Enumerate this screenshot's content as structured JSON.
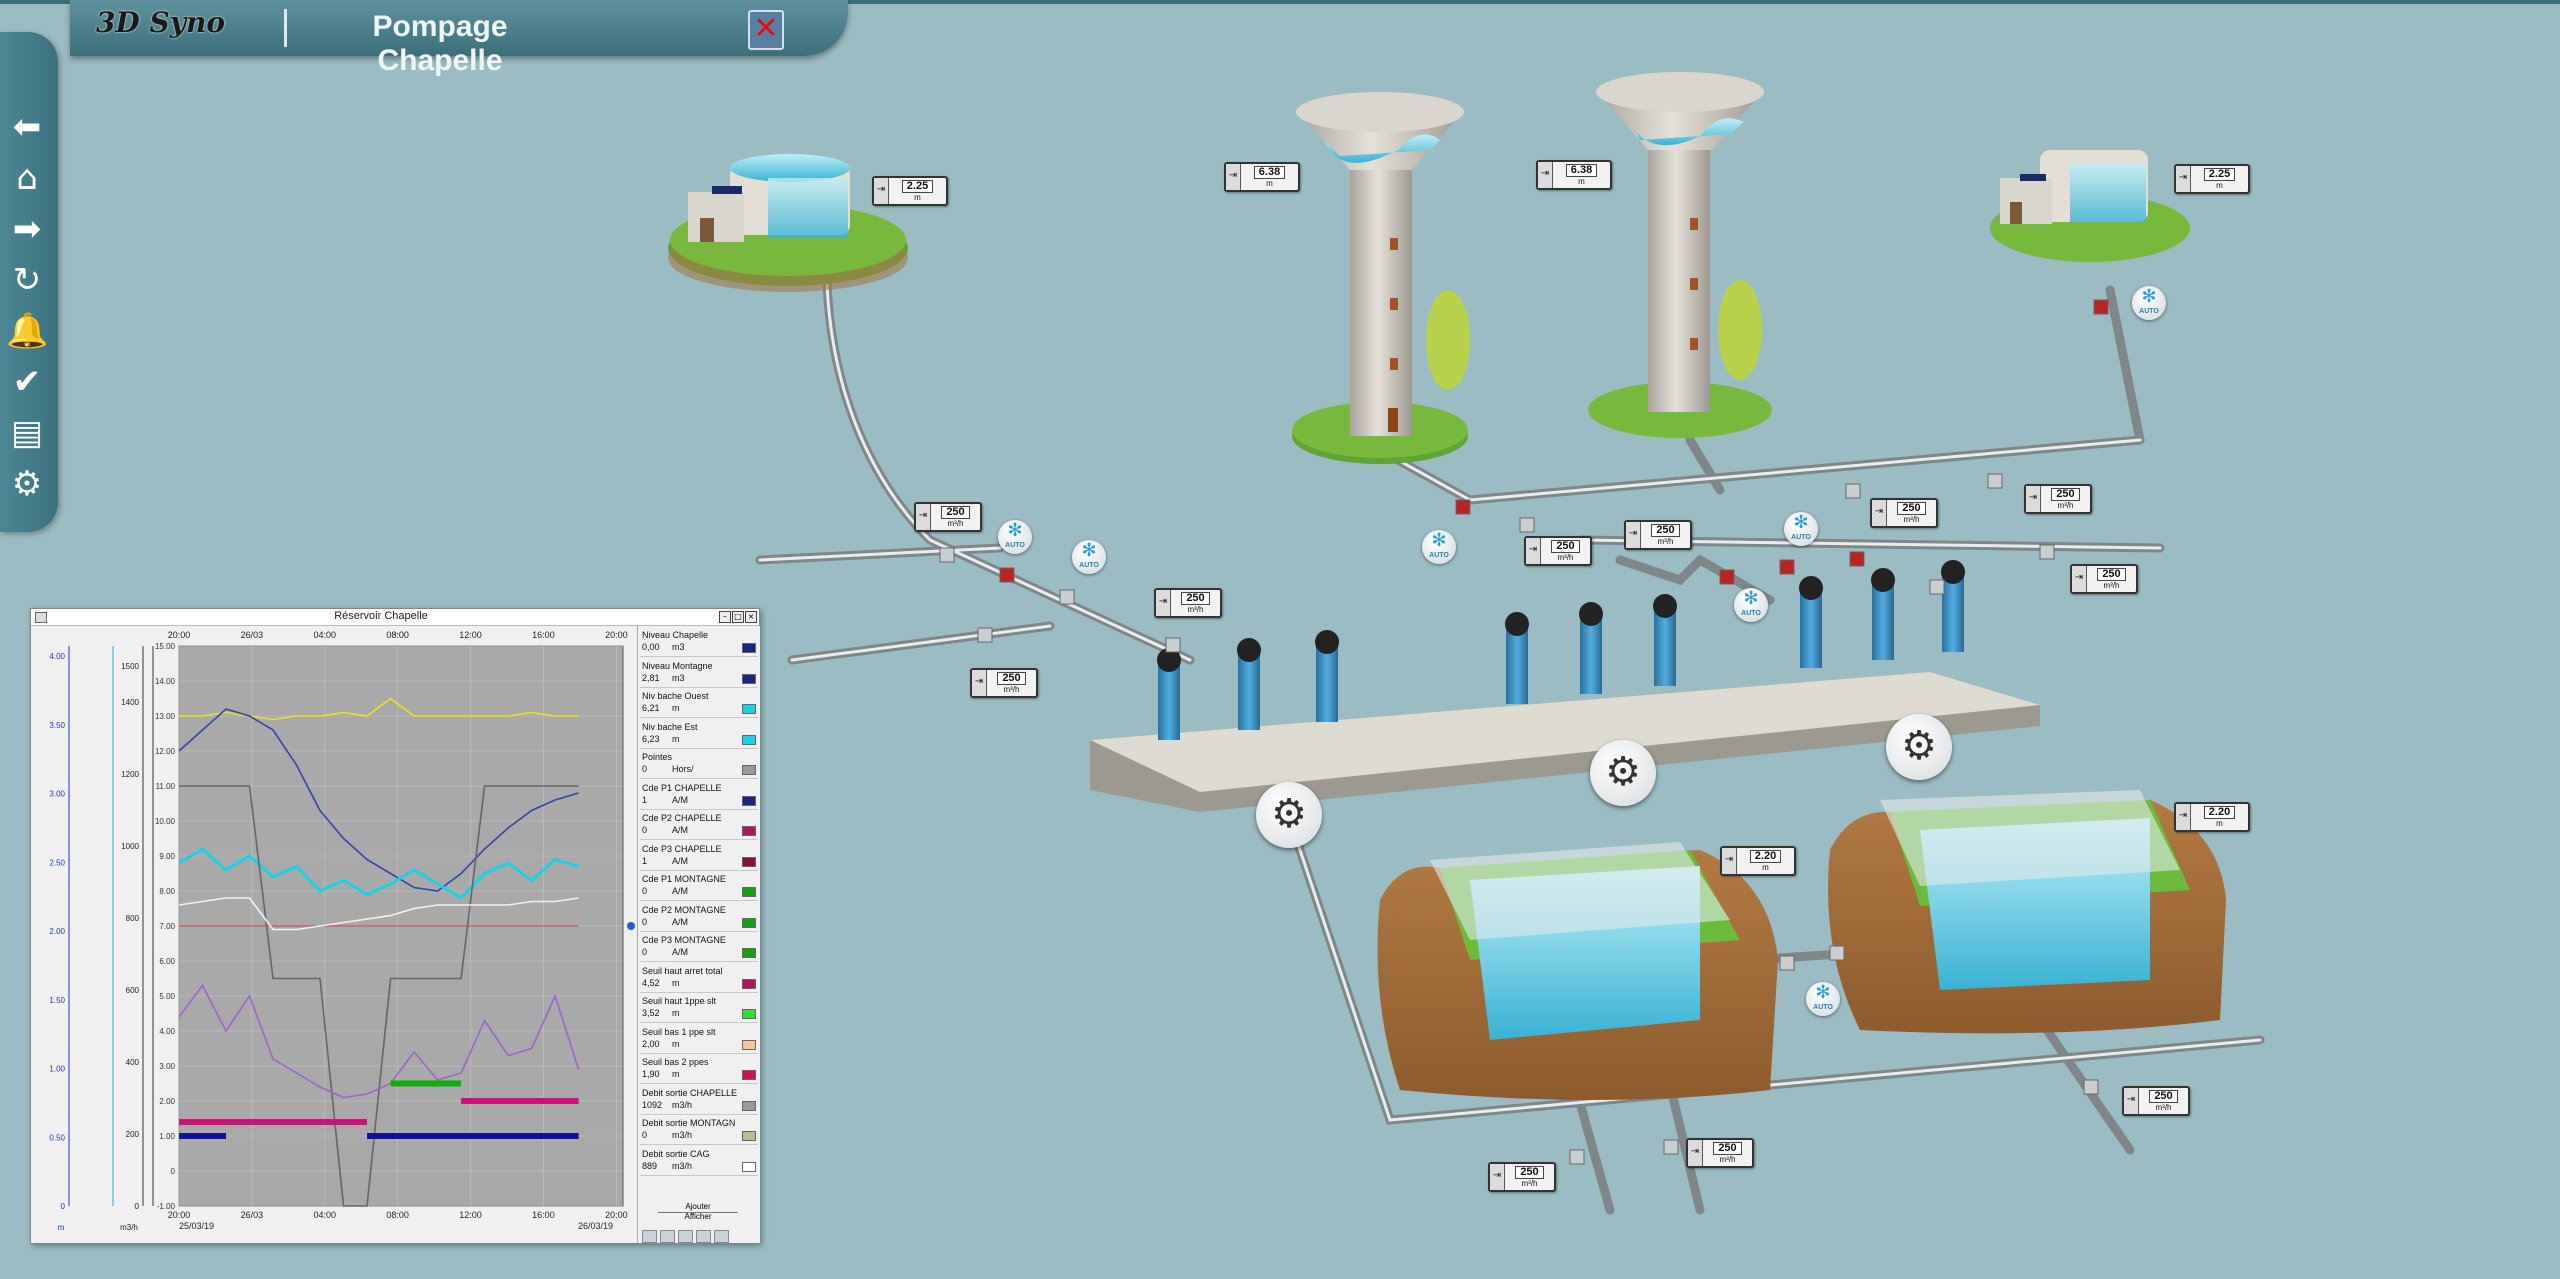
{
  "header": {
    "logo": "3D Syno",
    "title": "Pompage Chapelle",
    "close_glyph": "✕"
  },
  "sidebar": {
    "items": [
      {
        "name": "back-arrow-icon",
        "glyph": "⬅"
      },
      {
        "name": "home-icon",
        "glyph": "⌂"
      },
      {
        "name": "forward-arrow-icon",
        "glyph": "➡"
      },
      {
        "name": "refresh-icon",
        "glyph": "↻"
      },
      {
        "name": "alarm-bell-icon",
        "glyph": "🔔"
      },
      {
        "name": "checkmark-icon",
        "glyph": "✔"
      },
      {
        "name": "table-icon",
        "glyph": "▤"
      },
      {
        "name": "settings-gears-icon",
        "glyph": "⚙"
      }
    ]
  },
  "gauges": {
    "res_ouest": {
      "value": "2.25",
      "unit": "m"
    },
    "res_est": {
      "value": "2.25",
      "unit": "m"
    },
    "tower_1": {
      "value": "6.38",
      "unit": "m"
    },
    "tower_2": {
      "value": "6.38",
      "unit": "m"
    },
    "bache_1": {
      "value": "2.20",
      "unit": "m"
    },
    "bache_2": {
      "value": "2.20",
      "unit": "m"
    },
    "flow_left_1": {
      "value": "250",
      "unit": "m³/h"
    },
    "flow_left_2": {
      "value": "250",
      "unit": "m³/h"
    },
    "flow_left_3": {
      "value": "250",
      "unit": "m³/h"
    },
    "flow_mid_1": {
      "value": "250",
      "unit": "m³/h"
    },
    "flow_mid_2": {
      "value": "250",
      "unit": "m³/h"
    },
    "flow_right_1": {
      "value": "250",
      "unit": "m³/h"
    },
    "flow_right_2": {
      "value": "250",
      "unit": "m³/h"
    },
    "flow_right_3": {
      "value": "250",
      "unit": "m³/h"
    },
    "flow_bottom_1": {
      "value": "250",
      "unit": "m³/h"
    },
    "flow_bottom_2": {
      "value": "250",
      "unit": "m³/h"
    },
    "flow_bottom_3": {
      "value": "250",
      "unit": "m³/h"
    }
  },
  "auto_label": "AUTO",
  "chart_window": {
    "title": "Réservoir Chapelle",
    "add_label": "Ajouter",
    "show_label": "Afficher"
  },
  "chart_data": {
    "type": "line",
    "top_ticks": [
      "20:00",
      "26/03",
      "04:00",
      "08:00",
      "12:00",
      "16:00",
      "20:00"
    ],
    "bottom_ticks": [
      "20:00",
      "26/03",
      "04:00",
      "08:00",
      "12:00",
      "16:00",
      "20:00"
    ],
    "bottom_dates": [
      "25/03/19",
      "26/03/19"
    ],
    "axis1": {
      "color": "#2233cc",
      "ticks": [
        "0",
        "0.50",
        "1.00",
        "1.50",
        "2.00",
        "2.50",
        "3.00",
        "3.50",
        "4.00"
      ],
      "unit": "m"
    },
    "axis2": {
      "color": "#33aacc",
      "ticks": [
        "0",
        "200",
        "400",
        "600",
        "800",
        "1000",
        "1200",
        "1400",
        "1500"
      ],
      "unit": "m3/h"
    },
    "axis3": {
      "color": "#333333",
      "ticks": [
        "-1.00",
        "0",
        "1.00",
        "2.00",
        "3.00",
        "4.00",
        "5.00",
        "6.00",
        "7.00",
        "8.00",
        "9.00",
        "10.00",
        "11.00",
        "12.00",
        "13.00",
        "14.00",
        "15.00"
      ]
    },
    "series": [
      {
        "color": "#e6e619",
        "y": [
          13.0,
          13.0,
          13.1,
          13.0,
          12.9,
          13.0,
          13.0,
          13.1,
          13.0,
          13.5,
          13.0,
          13.0,
          13.0,
          13.0,
          13.0,
          13.1,
          13.0,
          13.0
        ]
      },
      {
        "color": "#3344aa",
        "y": [
          12.0,
          12.6,
          13.2,
          13.0,
          12.6,
          11.6,
          10.3,
          9.5,
          8.9,
          8.5,
          8.1,
          8.0,
          8.5,
          9.2,
          9.8,
          10.3,
          10.6,
          10.8
        ]
      },
      {
        "color": "#19d2e6",
        "y": [
          8.8,
          9.2,
          8.6,
          9.0,
          8.4,
          8.7,
          8.0,
          8.3,
          7.9,
          8.2,
          8.6,
          8.2,
          7.8,
          8.5,
          8.8,
          8.3,
          8.9,
          8.7
        ]
      },
      {
        "color": "#666666",
        "y": [
          11.0,
          11.0,
          11.0,
          11.0,
          5.5,
          5.5,
          5.5,
          -1.0,
          -1.0,
          5.5,
          5.5,
          5.5,
          5.5,
          11.0,
          11.0,
          11.0,
          11.0,
          11.0
        ]
      },
      {
        "color": "#f2f2f2",
        "y": [
          7.6,
          7.7,
          7.8,
          7.8,
          6.9,
          6.9,
          7.0,
          7.1,
          7.2,
          7.3,
          7.5,
          7.6,
          7.6,
          7.6,
          7.6,
          7.7,
          7.7,
          7.8
        ]
      },
      {
        "color": "#9966cc",
        "y": [
          4.4,
          5.3,
          4.0,
          5.0,
          3.2,
          2.8,
          2.4,
          2.1,
          2.2,
          2.5,
          3.4,
          2.6,
          2.8,
          4.3,
          3.3,
          3.5,
          5.0,
          2.9
        ]
      }
    ],
    "bands": [
      {
        "color": "#cc1177",
        "y": 1.4,
        "from": 0,
        "to": 8
      },
      {
        "color": "#11aa11",
        "y": 2.5,
        "from": 9,
        "to": 12
      },
      {
        "color": "#cc1177",
        "y": 2.0,
        "from": 12,
        "to": 17
      },
      {
        "color": "#111199",
        "y": 1.0,
        "from": 0,
        "to": 2
      },
      {
        "color": "#111199",
        "y": 1.0,
        "from": 8,
        "to": 17
      }
    ],
    "ref_lines": [
      {
        "color": "#dd4444",
        "y": 7.0
      }
    ]
  },
  "legend": [
    {
      "name": "Niveau Chapelle",
      "value": "0,00",
      "unit": "m3",
      "color": "#1a237e"
    },
    {
      "name": "Niveau Montagne",
      "value": "2,81",
      "unit": "m3",
      "color": "#1a237e"
    },
    {
      "name": "Niv bache Ouest",
      "value": "6,21",
      "unit": "m",
      "color": "#19d2e6"
    },
    {
      "name": "Niv bache Est",
      "value": "6,23",
      "unit": "m",
      "color": "#19d2e6"
    },
    {
      "name": "Pointes",
      "value": "0",
      "unit": "Hors/",
      "color": "#999999"
    },
    {
      "name": "Cde P1 CHAPELLE",
      "value": "1",
      "unit": "A/M",
      "color": "#1a237e"
    },
    {
      "name": "Cde P2 CHAPELLE",
      "value": "0",
      "unit": "A/M",
      "color": "#b0155e"
    },
    {
      "name": "Cde P3 CHAPELLE",
      "value": "1",
      "unit": "A/M",
      "color": "#8b0e3a"
    },
    {
      "name": "Cde P1 MONTAGNE",
      "value": "0",
      "unit": "A/M",
      "color": "#13a013"
    },
    {
      "name": "Cde P2 MONTAGNE",
      "value": "0",
      "unit": "A/M",
      "color": "#13a013"
    },
    {
      "name": "Cde P3 MONTAGNE",
      "value": "0",
      "unit": "A/M",
      "color": "#13a013"
    },
    {
      "name": "Seuil haut arret total",
      "value": "4,52",
      "unit": "m",
      "color": "#b0155e"
    },
    {
      "name": "Seuil haut 1ppe slt",
      "value": "3,52",
      "unit": "m",
      "color": "#33dd33"
    },
    {
      "name": "Seuil bas 1 ppe slt",
      "value": "2,00",
      "unit": "m",
      "color": "#f3c79a"
    },
    {
      "name": "Seuil  bas 2 ppes",
      "value": "1,90",
      "unit": "m",
      "color": "#cc1155"
    },
    {
      "name": "Debit sortie CHAPELLE",
      "value": "1092",
      "unit": "m3/h",
      "color": "#999999"
    },
    {
      "name": "Debit sortie MONTAGN",
      "value": "0",
      "unit": "m3/h",
      "color": "#bbbb99"
    },
    {
      "name": "Debit sortie CAG",
      "value": "889",
      "unit": "m3/h",
      "color": "#ffffff"
    }
  ]
}
